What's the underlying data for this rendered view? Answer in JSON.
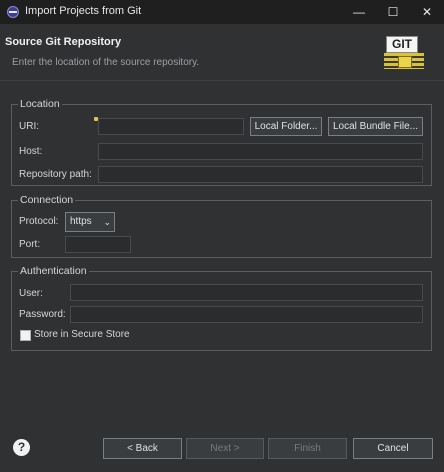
{
  "window": {
    "title": "Import Projects from Git",
    "minimize": "—",
    "maximize": "☐",
    "close": "✕"
  },
  "header": {
    "title": "Source Git Repository",
    "description": "Enter the location of the source repository.",
    "logo_text": "GIT"
  },
  "location": {
    "group_label": "Location",
    "uri_label": "URI:",
    "uri_value": "",
    "local_folder_button": "Local Folder...",
    "local_bundle_button": "Local Bundle File...",
    "host_label": "Host:",
    "host_value": "",
    "repo_path_label": "Repository path:",
    "repo_path_value": ""
  },
  "connection": {
    "group_label": "Connection",
    "protocol_label": "Protocol:",
    "protocol_value": "https",
    "port_label": "Port:",
    "port_value": ""
  },
  "authentication": {
    "group_label": "Authentication",
    "user_label": "User:",
    "user_value": "",
    "password_label": "Password:",
    "password_value": "",
    "store_label": "Store in Secure Store",
    "store_checked": false
  },
  "footer": {
    "help": "?",
    "back": "< Back",
    "next": "Next >",
    "finish": "Finish",
    "cancel": "Cancel"
  },
  "colors": {
    "background": "#2f3133",
    "titlebar": "#1f1f1f",
    "accent_logo": "#d8c23b"
  }
}
